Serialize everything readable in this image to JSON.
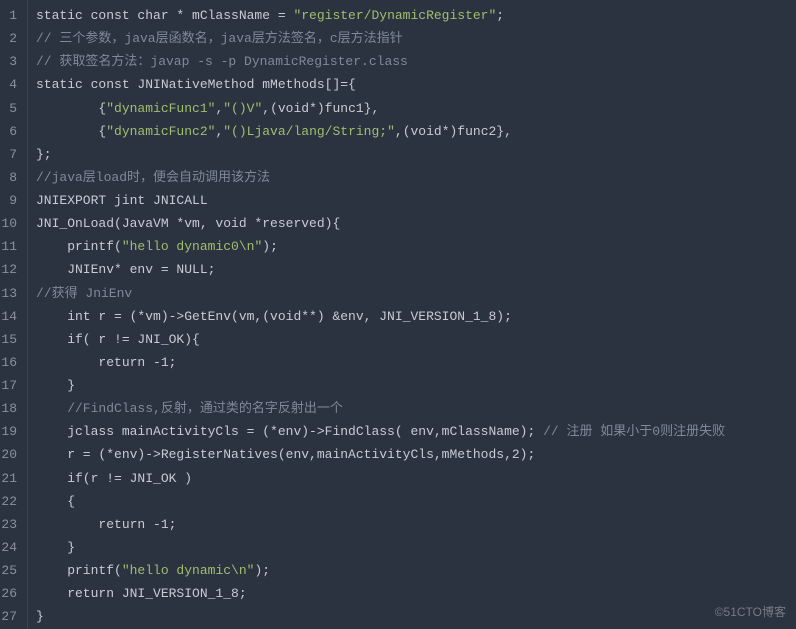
{
  "watermark": "©51CTO博客",
  "lines": [
    {
      "n": 1,
      "segs": [
        {
          "t": "static const char * mClassName = ",
          "c": "kw"
        },
        {
          "t": "\"register/DynamicRegister\"",
          "c": "str"
        },
        {
          "t": ";",
          "c": "kw"
        }
      ]
    },
    {
      "n": 2,
      "segs": [
        {
          "t": "// 三个参数，java层函数名，java层方法签名，c层方法指针",
          "c": "cmt"
        }
      ]
    },
    {
      "n": 3,
      "segs": [
        {
          "t": "// 获取签名方法：javap -s -p DynamicRegister.class",
          "c": "cmt"
        }
      ]
    },
    {
      "n": 4,
      "segs": [
        {
          "t": "static const JNINativeMethod mMethods[]={",
          "c": "kw"
        }
      ]
    },
    {
      "n": 5,
      "segs": [
        {
          "t": "        {",
          "c": "kw"
        },
        {
          "t": "\"dynamicFunc1\"",
          "c": "str"
        },
        {
          "t": ",",
          "c": "kw"
        },
        {
          "t": "\"()V\"",
          "c": "str"
        },
        {
          "t": ",(void*)func1},",
          "c": "kw"
        }
      ]
    },
    {
      "n": 6,
      "segs": [
        {
          "t": "        {",
          "c": "kw"
        },
        {
          "t": "\"dynamicFunc2\"",
          "c": "str"
        },
        {
          "t": ",",
          "c": "kw"
        },
        {
          "t": "\"()Ljava/lang/String;\"",
          "c": "str"
        },
        {
          "t": ",(void*)func2},",
          "c": "kw"
        }
      ]
    },
    {
      "n": 7,
      "segs": [
        {
          "t": "};",
          "c": "kw"
        }
      ]
    },
    {
      "n": 8,
      "segs": [
        {
          "t": "//java层load时，便会自动调用该方法",
          "c": "cmt"
        }
      ]
    },
    {
      "n": 9,
      "segs": [
        {
          "t": "JNIEXPORT jint JNICALL",
          "c": "kw"
        }
      ]
    },
    {
      "n": 10,
      "segs": [
        {
          "t": "JNI_OnLoad(JavaVM *vm, void *reserved){",
          "c": "kw"
        }
      ]
    },
    {
      "n": 11,
      "segs": [
        {
          "t": "    printf(",
          "c": "kw"
        },
        {
          "t": "\"hello dynamic0\\n\"",
          "c": "str"
        },
        {
          "t": ");",
          "c": "kw"
        }
      ]
    },
    {
      "n": 12,
      "segs": [
        {
          "t": "    JNIEnv* env = NULL;",
          "c": "kw"
        }
      ]
    },
    {
      "n": 13,
      "segs": [
        {
          "t": "//获得 JniEnv",
          "c": "cmt"
        }
      ]
    },
    {
      "n": 14,
      "segs": [
        {
          "t": "    int r = (*vm)->GetEnv(vm,(void**) &env, JNI_VERSION_1_8);",
          "c": "kw"
        }
      ]
    },
    {
      "n": 15,
      "segs": [
        {
          "t": "    if( r != JNI_OK){",
          "c": "kw"
        }
      ]
    },
    {
      "n": 16,
      "segs": [
        {
          "t": "        return -1;",
          "c": "kw"
        }
      ]
    },
    {
      "n": 17,
      "segs": [
        {
          "t": "    }",
          "c": "kw"
        }
      ]
    },
    {
      "n": 18,
      "segs": [
        {
          "t": "    //FindClass,反射，通过类的名字反射出一个",
          "c": "cmt"
        }
      ]
    },
    {
      "n": 19,
      "segs": [
        {
          "t": "    jclass mainActivityCls = (*env)->FindClass( env,mClassName); ",
          "c": "kw"
        },
        {
          "t": "// 注册 如果小于0则注册失败",
          "c": "cmt"
        }
      ]
    },
    {
      "n": 20,
      "segs": [
        {
          "t": "    r = (*env)->RegisterNatives(env,mainActivityCls,mMethods,2);",
          "c": "kw"
        }
      ]
    },
    {
      "n": 21,
      "segs": [
        {
          "t": "    if(r != JNI_OK )",
          "c": "kw"
        }
      ]
    },
    {
      "n": 22,
      "segs": [
        {
          "t": "    {",
          "c": "kw"
        }
      ]
    },
    {
      "n": 23,
      "segs": [
        {
          "t": "        return -1;",
          "c": "kw"
        }
      ]
    },
    {
      "n": 24,
      "segs": [
        {
          "t": "    }",
          "c": "kw"
        }
      ]
    },
    {
      "n": 25,
      "segs": [
        {
          "t": "    printf(",
          "c": "kw"
        },
        {
          "t": "\"hello dynamic\\n\"",
          "c": "str"
        },
        {
          "t": ");",
          "c": "kw"
        }
      ]
    },
    {
      "n": 26,
      "segs": [
        {
          "t": "    return JNI_VERSION_1_8;",
          "c": "kw"
        }
      ]
    },
    {
      "n": 27,
      "segs": [
        {
          "t": "}",
          "c": "kw"
        }
      ]
    }
  ]
}
